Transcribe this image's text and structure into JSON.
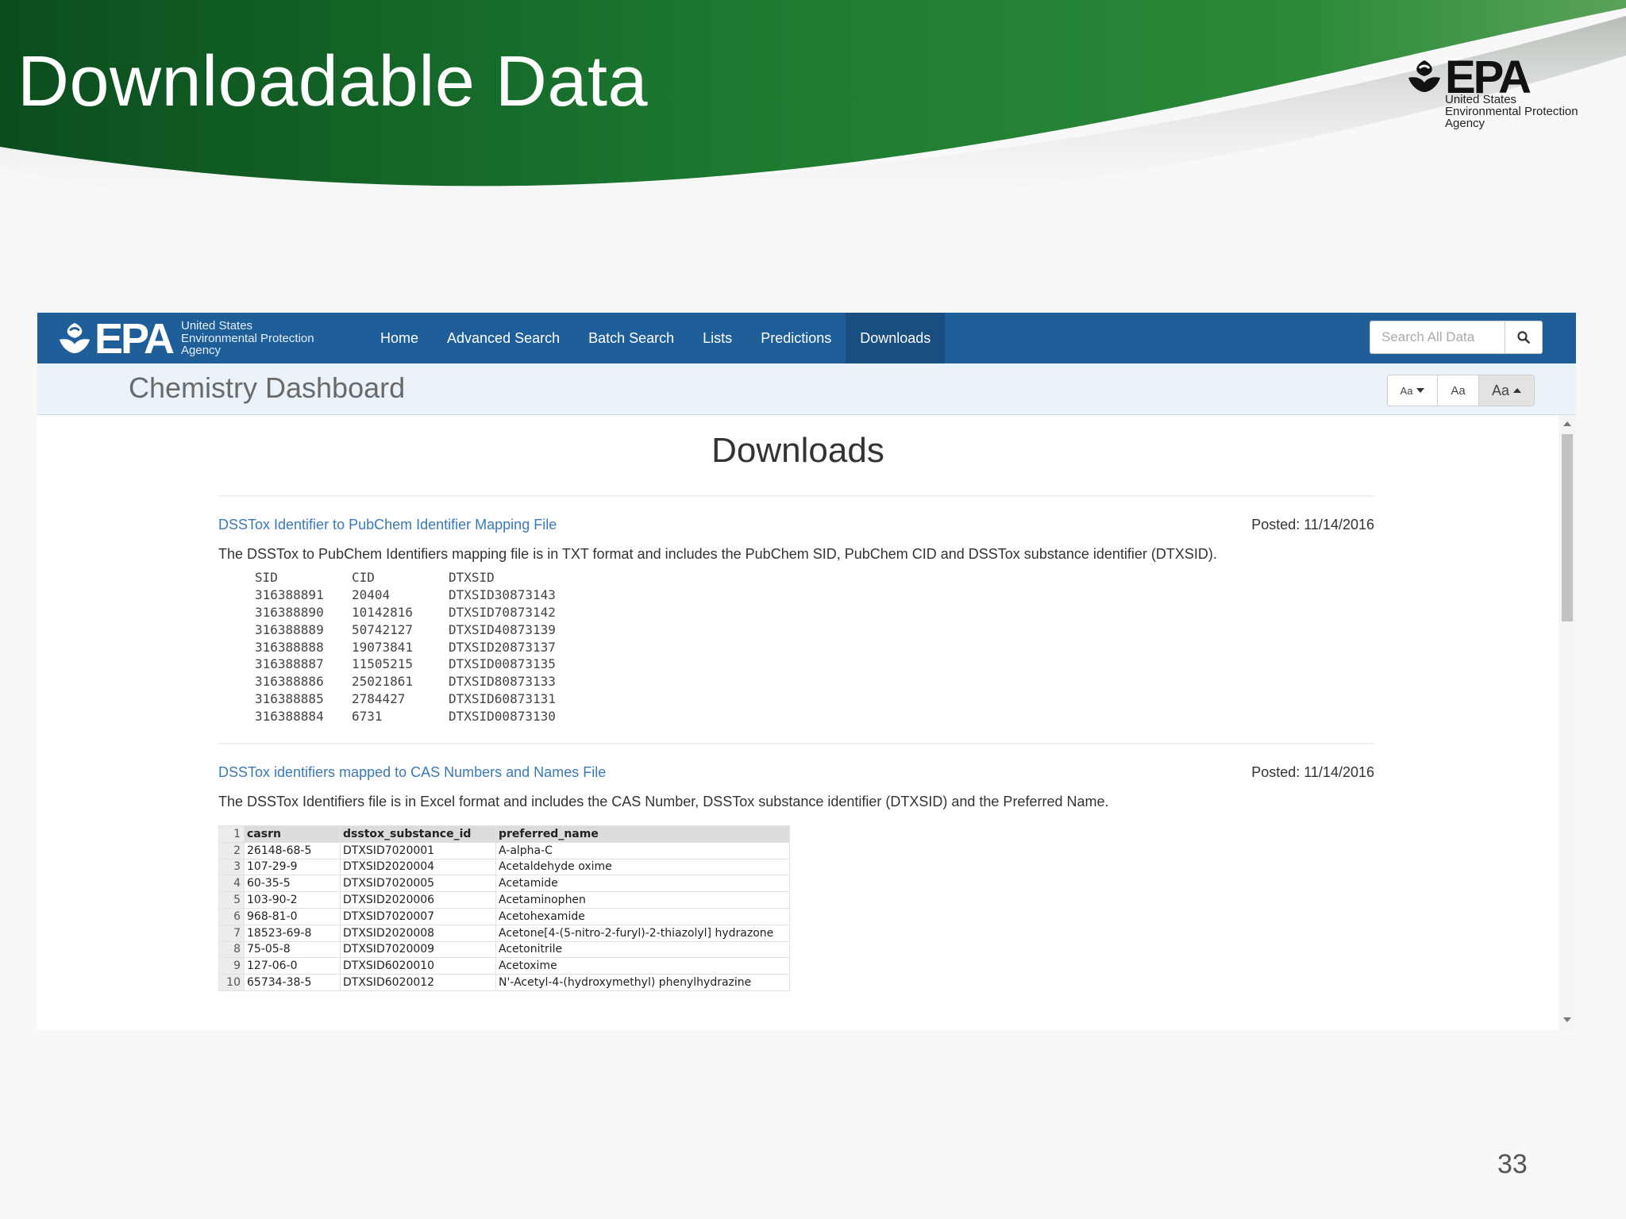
{
  "slide": {
    "title": "Downloadable Data",
    "logo": {
      "word": "EPA",
      "line1": "United States",
      "line2": "Environmental Protection",
      "line3": "Agency"
    },
    "page_number": "33",
    "colors": {
      "banner_dark": "#0b4d1e",
      "banner_light": "#2e8a3a"
    }
  },
  "app": {
    "navbar": {
      "logo": {
        "word": "EPA",
        "line1": "United States",
        "line2": "Environmental Protection",
        "line3": "Agency"
      },
      "items": [
        {
          "label": "Home",
          "active": false
        },
        {
          "label": "Advanced Search",
          "active": false
        },
        {
          "label": "Batch Search",
          "active": false
        },
        {
          "label": "Lists",
          "active": false
        },
        {
          "label": "Predictions",
          "active": false
        },
        {
          "label": "Downloads",
          "active": true
        }
      ],
      "search_placeholder": "Search All Data",
      "search_icon": "magnifier-icon",
      "color": "#1f5f99"
    },
    "subbar": {
      "title": "Chemistry Dashboard",
      "font_buttons": [
        "Aa",
        "Aa",
        "Aa"
      ]
    },
    "page_heading": "Downloads",
    "downloads": [
      {
        "link": "DSSTox Identifier to PubChem Identifier Mapping File",
        "posted": "Posted: 11/14/2016",
        "description": "The DSSTox to PubChem Identifiers mapping file is in TXT format and includes the PubChem SID, PubChem CID and DSSTox substance identifier (DTXSID).",
        "preview": {
          "headers": [
            "SID",
            "CID",
            "DTXSID"
          ],
          "rows": [
            [
              "316388891",
              "20404",
              "DTXSID30873143"
            ],
            [
              "316388890",
              "10142816",
              "DTXSID70873142"
            ],
            [
              "316388889",
              "50742127",
              "DTXSID40873139"
            ],
            [
              "316388888",
              "19073841",
              "DTXSID20873137"
            ],
            [
              "316388887",
              "11505215",
              "DTXSID00873135"
            ],
            [
              "316388886",
              "25021861",
              "DTXSID80873133"
            ],
            [
              "316388885",
              "2784427",
              "DTXSID60873131"
            ],
            [
              "316388884",
              "6731",
              "DTXSID00873130"
            ]
          ]
        }
      },
      {
        "link": "DSSTox identifiers mapped to CAS Numbers and Names File",
        "posted": "Posted: 11/14/2016",
        "description": "The DSSTox Identifiers file is in Excel format and includes the CAS Number, DSSTox substance identifier (DTXSID) and the Preferred Name.",
        "preview": {
          "headers": [
            "casrn",
            "dsstox_substance_id",
            "preferred_name"
          ],
          "rows": [
            [
              "26148-68-5",
              "DTXSID7020001",
              "A-alpha-C"
            ],
            [
              "107-29-9",
              "DTXSID2020004",
              "Acetaldehyde oxime"
            ],
            [
              "60-35-5",
              "DTXSID7020005",
              "Acetamide"
            ],
            [
              "103-90-2",
              "DTXSID2020006",
              "Acetaminophen"
            ],
            [
              "968-81-0",
              "DTXSID7020007",
              "Acetohexamide"
            ],
            [
              "18523-69-8",
              "DTXSID2020008",
              "Acetone[4-(5-nitro-2-furyl)-2-thiazolyl] hydrazone"
            ],
            [
              "75-05-8",
              "DTXSID7020009",
              "Acetonitrile"
            ],
            [
              "127-06-0",
              "DTXSID6020010",
              "Acetoxime"
            ],
            [
              "65734-38-5",
              "DTXSID6020012",
              "N'-Acetyl-4-(hydroxymethyl) phenylhydrazine"
            ]
          ]
        }
      }
    ]
  }
}
